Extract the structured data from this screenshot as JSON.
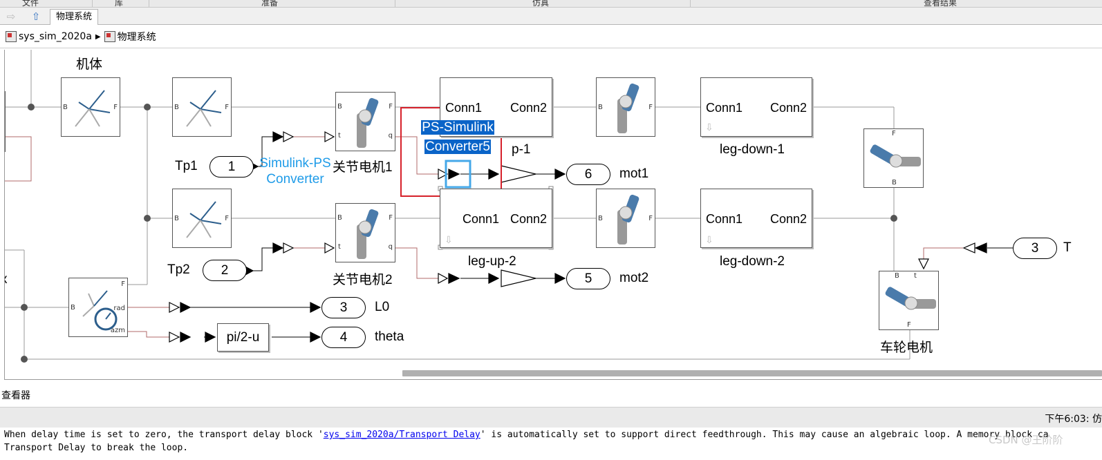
{
  "ribbon": {
    "groups": [
      "文件",
      "库",
      "准备",
      "仿真",
      "查看结果"
    ]
  },
  "tab": {
    "label": "物理系统"
  },
  "breadcrumb": {
    "model": "sys_sim_2020a",
    "subsystem": "物理系统"
  },
  "blocks": {
    "body_label": "机体",
    "port_b": "B",
    "port_f": "F",
    "port_q": "q",
    "port_t": "t",
    "port_rad": "rad",
    "port_azm": "azm",
    "joint1_label": "关节电机1",
    "joint2_label": "关节电机2",
    "wheel_label": "车轮电机",
    "conn1": "Conn1",
    "conn2": "Conn2",
    "leg_up_1_suffix": "p-1",
    "leg_up_2": "leg-up-2",
    "leg_down_1": "leg-down-1",
    "leg_down_2": "leg-down-2",
    "sim_ps_line1": "Simulink-PS",
    "sim_ps_line2": "Converter",
    "ps_sim_line1": "PS-Simulink",
    "ps_sim_line2": "Converter5",
    "fcn": "pi/2-u",
    "left_clip_label": "x"
  },
  "inports": [
    {
      "num": "1",
      "name": "Tp1"
    },
    {
      "num": "2",
      "name": "Tp2"
    },
    {
      "num": "3",
      "name": "T"
    }
  ],
  "outports": [
    {
      "num": "6",
      "name": "mot1"
    },
    {
      "num": "5",
      "name": "mot2"
    },
    {
      "num": "3",
      "name": "L0"
    },
    {
      "num": "4",
      "name": "theta"
    }
  ],
  "viewer": {
    "label": "查看器"
  },
  "status": {
    "time": "下午6:03: 仿"
  },
  "diagnostic": {
    "line1_pre": "When delay time is set to zero, the transport delay block '",
    "line1_link": "sys_sim_2020a/Transport Delay",
    "line1_post": "' is automatically set to support direct feedthrough. This may cause an algebraic loop. A memory block ca",
    "line2": "Transport Delay to break the loop."
  },
  "watermark": "CSDN @王阶阶",
  "colors": {
    "selection": "#0a64c8",
    "selection_box": "#d6202a",
    "signal_line": "#b06a6a",
    "converter_text": "#1e9be8"
  }
}
